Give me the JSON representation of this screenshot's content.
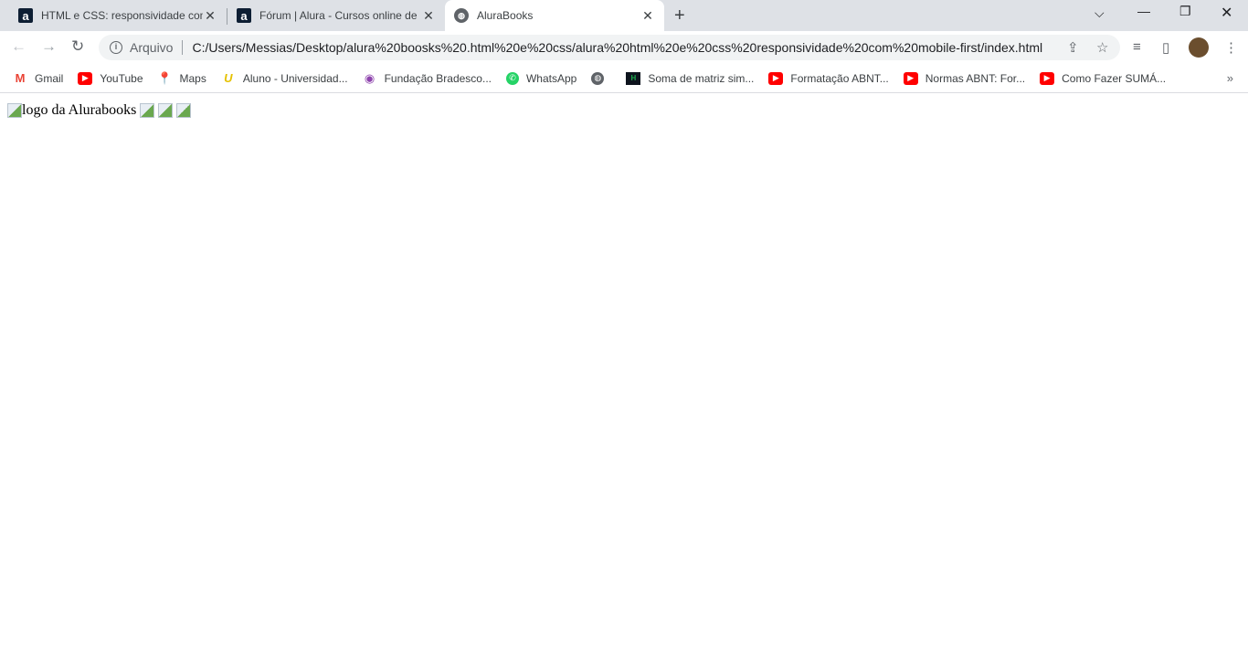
{
  "tabs": [
    {
      "title": "HTML e CSS: responsividade com",
      "icon": "alura-icon",
      "active": false
    },
    {
      "title": "Fórum | Alura - Cursos online de",
      "icon": "alura-icon",
      "active": false
    },
    {
      "title": "AluraBooks",
      "icon": "globe-icon",
      "active": true
    }
  ],
  "toolbar": {
    "security_label": "Arquivo",
    "url": "C:/Users/Messias/Desktop/alura%20boosks%20.html%20e%20css/alura%20html%20e%20css%20responsividade%20com%20mobile-first/index.html"
  },
  "bookmarks": [
    {
      "label": "Gmail",
      "icon": "gmail-icon"
    },
    {
      "label": "YouTube",
      "icon": "youtube-icon"
    },
    {
      "label": "Maps",
      "icon": "maps-icon"
    },
    {
      "label": "Aluno - Universidad...",
      "icon": "unopar-icon"
    },
    {
      "label": "Fundação Bradesco...",
      "icon": "bradesco-icon"
    },
    {
      "label": "WhatsApp",
      "icon": "whatsapp-icon"
    },
    {
      "label": "",
      "icon": "globe-icon"
    },
    {
      "label": "Soma de matriz sim...",
      "icon": "hackerrank-icon"
    },
    {
      "label": "Formatação ABNT...",
      "icon": "youtube-icon"
    },
    {
      "label": "Normas ABNT: For...",
      "icon": "youtube-icon"
    },
    {
      "label": "Como Fazer SUMÁ...",
      "icon": "youtube-icon"
    }
  ],
  "page": {
    "logo_alt": "logo da Alurabooks",
    "broken_images": 3
  }
}
